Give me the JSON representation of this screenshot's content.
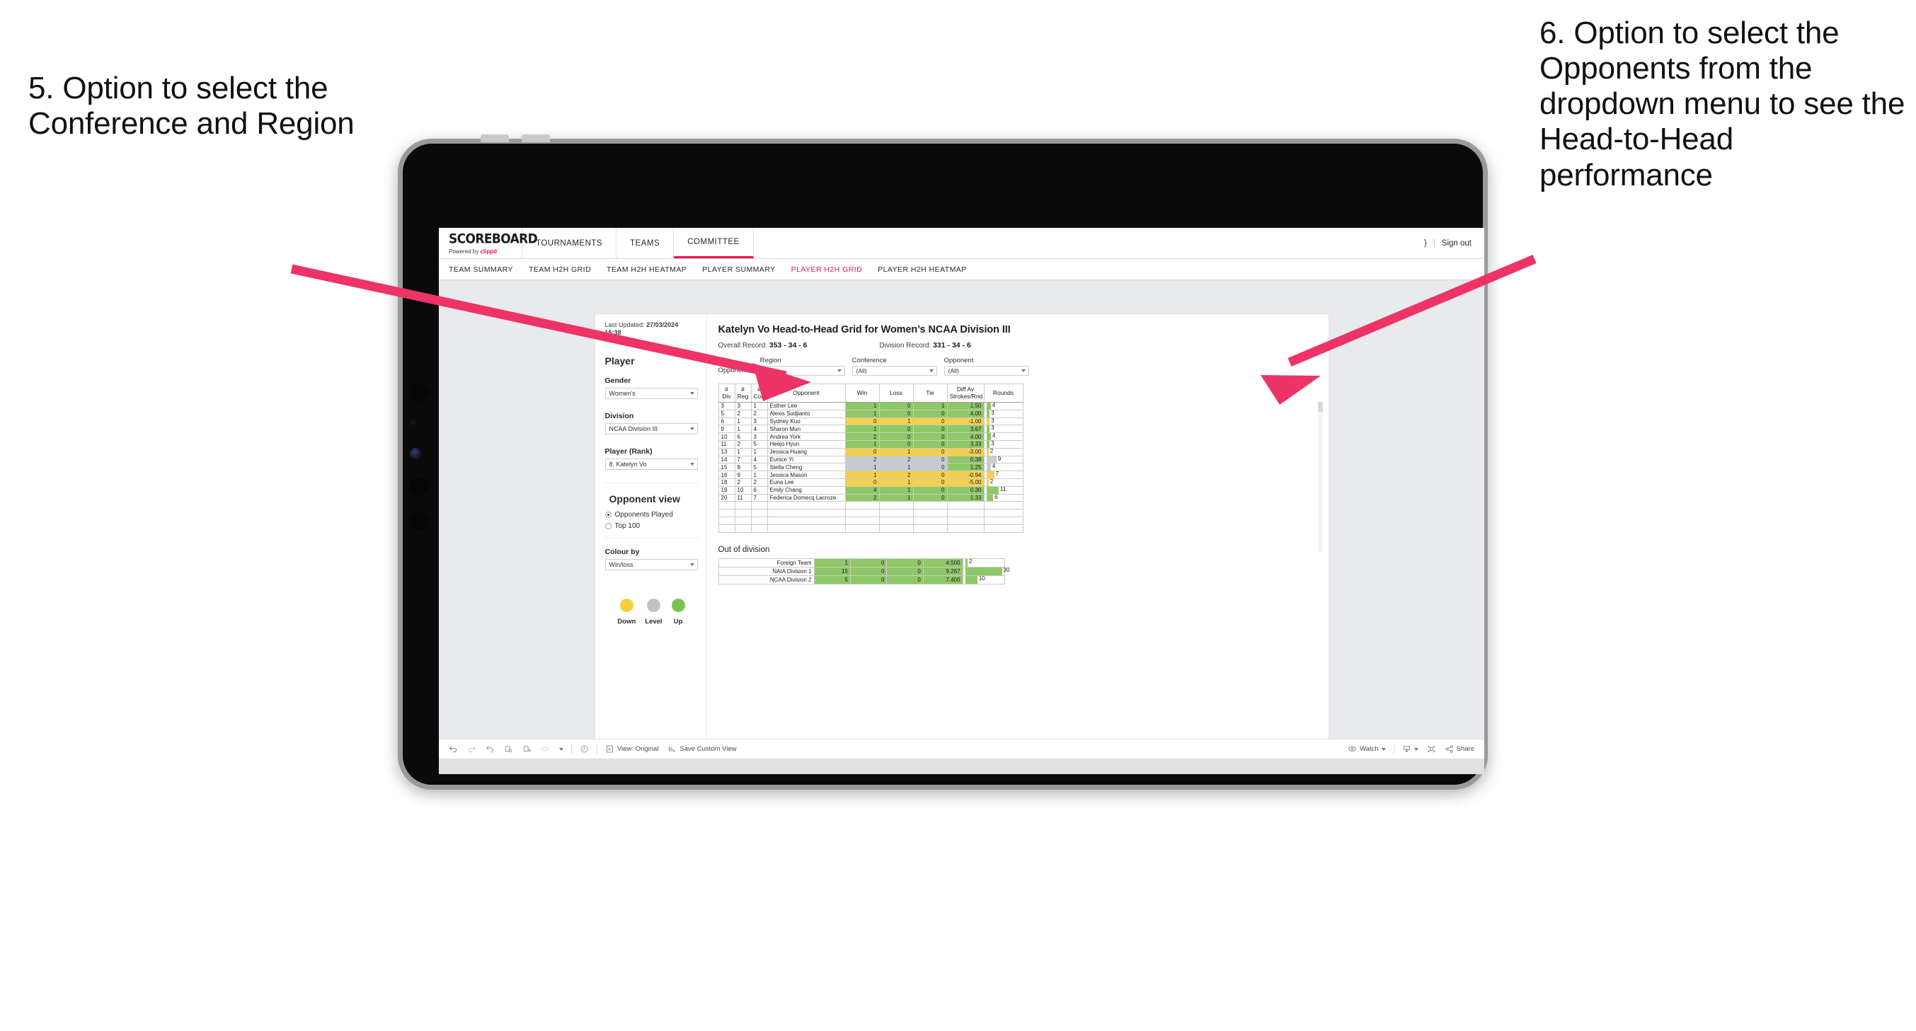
{
  "annotations": {
    "left": "5. Option to select the Conference and Region",
    "right": "6. Option to select the Opponents from the dropdown menu to see the Head-to-Head performance",
    "arrow_color": "#ee3366"
  },
  "app": {
    "brand": {
      "name": "SCOREBOARD",
      "powered_prefix": "Powered by",
      "powered_brand": "clippd"
    },
    "topnav": [
      {
        "label": "TOURNAMENTS",
        "active": false
      },
      {
        "label": "TEAMS",
        "active": false
      },
      {
        "label": "COMMITTEE",
        "active": true
      }
    ],
    "topbar_right": {
      "user_glyph": ")",
      "separator": "|",
      "signout": "Sign out"
    },
    "subnav": [
      {
        "label": "TEAM SUMMARY",
        "active": false
      },
      {
        "label": "TEAM H2H GRID",
        "active": false
      },
      {
        "label": "TEAM H2H HEATMAP",
        "active": false
      },
      {
        "label": "PLAYER SUMMARY",
        "active": false
      },
      {
        "label": "PLAYER H2H GRID",
        "active": true
      },
      {
        "label": "PLAYER H2H HEATMAP",
        "active": false
      }
    ]
  },
  "panel": {
    "last_updated_label": "Last Updated:",
    "last_updated_value": "27/03/2024",
    "last_updated_time": "15:38",
    "player_heading": "Player",
    "gender": {
      "label": "Gender",
      "value": "Women’s"
    },
    "division": {
      "label": "Division",
      "value": "NCAA Division III"
    },
    "player_rank": {
      "label": "Player (Rank)",
      "value": "8. Katelyn Vo"
    },
    "opponent_view": {
      "heading": "Opponent view",
      "options": [
        {
          "label": "Opponents Played",
          "selected": true
        },
        {
          "label": "Top 100",
          "selected": false
        }
      ]
    },
    "colour_by": {
      "label": "Colour by",
      "value": "Win/loss"
    },
    "legend": [
      {
        "label": "Down",
        "color": "#f5cf3f"
      },
      {
        "label": "Level",
        "color": "#c0c3c6"
      },
      {
        "label": "Up",
        "color": "#7cc24f"
      }
    ]
  },
  "viz": {
    "title": "Katelyn Vo Head-to-Head Grid for Women’s NCAA Division III",
    "overall_record_label": "Overall Record:",
    "overall_record_value": "353 - 34 - 6",
    "division_record_label": "Division Record:",
    "division_record_value": "331 - 34 - 6",
    "filters_prefix": "Opponents:",
    "filters": [
      {
        "label": "Region",
        "value": "(All)"
      },
      {
        "label": "Conference",
        "value": "(All)"
      },
      {
        "label": "Opponent",
        "value": "(All)"
      }
    ]
  },
  "chart_data": {
    "type": "table",
    "title": "Katelyn Vo Head-to-Head Grid for Women’s NCAA Division III",
    "columns": [
      "# Div",
      "# Reg",
      "# Conf",
      "Opponent",
      "Win",
      "Loss",
      "Tie",
      "Diff Av Strokes/Rnd",
      "Rounds"
    ],
    "column_header_lines": [
      [
        "#",
        "Div"
      ],
      [
        "#",
        "Reg"
      ],
      [
        "#",
        "Conf"
      ],
      [
        "Opponent"
      ],
      [
        "Win"
      ],
      [
        "Loss"
      ],
      [
        "Tie"
      ],
      [
        "Diff Av",
        "Strokes/Rnd"
      ],
      [
        "Rounds"
      ]
    ],
    "colour_encoding": {
      "up": "#8fc866",
      "down": "#f5d04e",
      "level": "#c9cccf"
    },
    "rounds_max": 30,
    "rows": [
      {
        "div": "3",
        "reg": "3",
        "conf": "1",
        "opponent": "Esther Lee",
        "win": "1",
        "loss": "0",
        "tie": "1",
        "diff": "1.50",
        "rounds": "4",
        "state": "up"
      },
      {
        "div": "5",
        "reg": "2",
        "conf": "2",
        "opponent": "Alexis Sudjianto",
        "win": "1",
        "loss": "0",
        "tie": "0",
        "diff": "4.00",
        "rounds": "3",
        "state": "up"
      },
      {
        "div": "6",
        "reg": "1",
        "conf": "3",
        "opponent": "Sydney Kuo",
        "win": "0",
        "loss": "1",
        "tie": "0",
        "diff": "-1.00",
        "rounds": "3",
        "state": "down"
      },
      {
        "div": "9",
        "reg": "1",
        "conf": "4",
        "opponent": "Sharon Mun",
        "win": "1",
        "loss": "0",
        "tie": "0",
        "diff": "3.67",
        "rounds": "3",
        "state": "up"
      },
      {
        "div": "10",
        "reg": "6",
        "conf": "3",
        "opponent": "Andrea York",
        "win": "2",
        "loss": "0",
        "tie": "0",
        "diff": "4.00",
        "rounds": "4",
        "state": "up"
      },
      {
        "div": "11",
        "reg": "2",
        "conf": "5",
        "opponent": "Heejo Hyun",
        "win": "1",
        "loss": "0",
        "tie": "0",
        "diff": "3.33",
        "rounds": "3",
        "state": "up"
      },
      {
        "div": "13",
        "reg": "1",
        "conf": "1",
        "opponent": "Jessica Huang",
        "win": "0",
        "loss": "1",
        "tie": "0",
        "diff": "-3.00",
        "rounds": "2",
        "state": "down"
      },
      {
        "div": "14",
        "reg": "7",
        "conf": "4",
        "opponent": "Eunice Yi",
        "win": "2",
        "loss": "2",
        "tie": "0",
        "diff": "0.38",
        "rounds": "9",
        "state": "level"
      },
      {
        "div": "15",
        "reg": "8",
        "conf": "5",
        "opponent": "Stella Cheng",
        "win": "1",
        "loss": "1",
        "tie": "0",
        "diff": "1.25",
        "rounds": "4",
        "state": "level"
      },
      {
        "div": "16",
        "reg": "9",
        "conf": "1",
        "opponent": "Jessica Mason",
        "win": "1",
        "loss": "2",
        "tie": "0",
        "diff": "-0.94",
        "rounds": "7",
        "state": "down"
      },
      {
        "div": "18",
        "reg": "2",
        "conf": "2",
        "opponent": "Euna Lee",
        "win": "0",
        "loss": "1",
        "tie": "0",
        "diff": "-5.00",
        "rounds": "2",
        "state": "down"
      },
      {
        "div": "19",
        "reg": "10",
        "conf": "6",
        "opponent": "Emily Chang",
        "win": "4",
        "loss": "1",
        "tie": "0",
        "diff": "0.30",
        "rounds": "11",
        "state": "up"
      },
      {
        "div": "20",
        "reg": "11",
        "conf": "7",
        "opponent": "Federica Domecq Lacroze",
        "win": "2",
        "loss": "1",
        "tie": "0",
        "diff": "1.33",
        "rounds": "6",
        "state": "up"
      }
    ],
    "out_of_division": {
      "title": "Out of division",
      "rows": [
        {
          "name": "Foreign Team",
          "win": "1",
          "loss": "0",
          "tie": "0",
          "diff": "4.500",
          "rounds": "2",
          "state": "up"
        },
        {
          "name": "NAIA Division 1",
          "win": "15",
          "loss": "0",
          "tie": "0",
          "diff": "9.267",
          "rounds": "30",
          "state": "up"
        },
        {
          "name": "NCAA Division 2",
          "win": "5",
          "loss": "0",
          "tie": "0",
          "diff": "7.400",
          "rounds": "10",
          "state": "up"
        }
      ]
    }
  },
  "toolbar": {
    "undo": "undo-icon",
    "redo": "redo-icon",
    "revert": "revert-icon",
    "refresh": "refresh-icon",
    "pause": "pause-icon",
    "view_original": "View: Original",
    "save_custom_view": "Save Custom View",
    "watch": "Watch",
    "share": "Share"
  }
}
